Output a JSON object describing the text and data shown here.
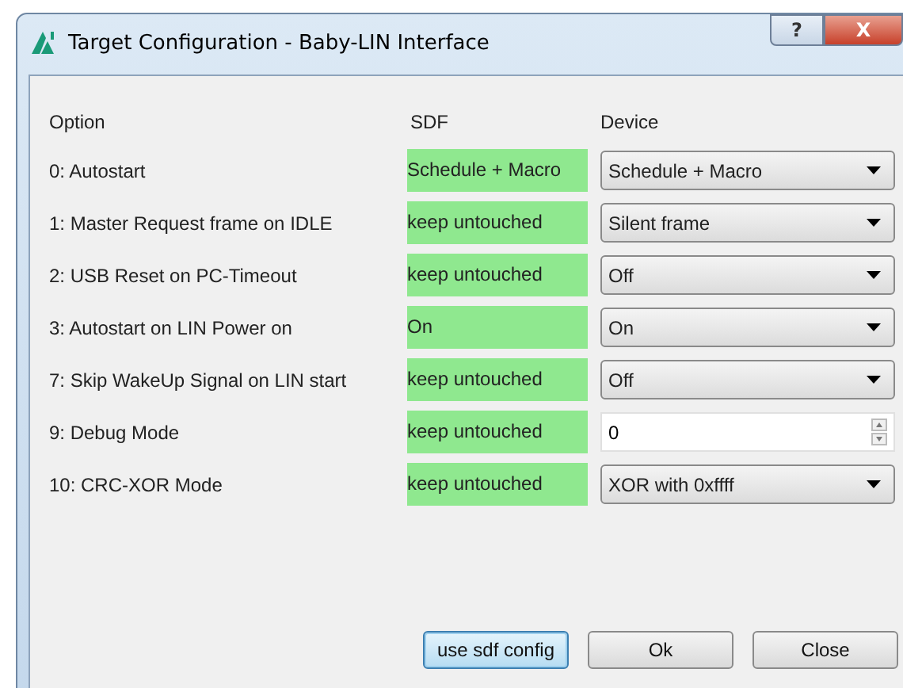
{
  "window": {
    "title": "Target Configuration - Baby-LIN Interface",
    "help": "?",
    "close": "X"
  },
  "table": {
    "columns": [
      "Option",
      "SDF",
      "Device"
    ],
    "rows": [
      {
        "option": "0: Autostart",
        "sdf": "Schedule + Macro",
        "kind": "combo",
        "device": "Schedule + Macro"
      },
      {
        "option": "1: Master Request frame on IDLE",
        "sdf": "keep untouched",
        "kind": "combo",
        "device": "Silent frame"
      },
      {
        "option": "2: USB Reset on PC-Timeout",
        "sdf": "keep untouched",
        "kind": "combo",
        "device": "Off"
      },
      {
        "option": "3: Autostart on LIN Power on",
        "sdf": "On",
        "kind": "combo",
        "device": "On"
      },
      {
        "option": "7: Skip WakeUp Signal on LIN start",
        "sdf": "keep untouched",
        "kind": "combo",
        "device": "Off"
      },
      {
        "option": "9: Debug Mode",
        "sdf": "keep untouched",
        "kind": "spin",
        "device": "0"
      },
      {
        "option": "10: CRC-XOR Mode",
        "sdf": "keep untouched",
        "kind": "combo",
        "device": "XOR with 0xffff"
      }
    ]
  },
  "buttons": [
    {
      "label": "use sdf config",
      "focused": true
    },
    {
      "label": "Ok",
      "focused": false
    },
    {
      "label": "Close",
      "focused": false
    }
  ]
}
